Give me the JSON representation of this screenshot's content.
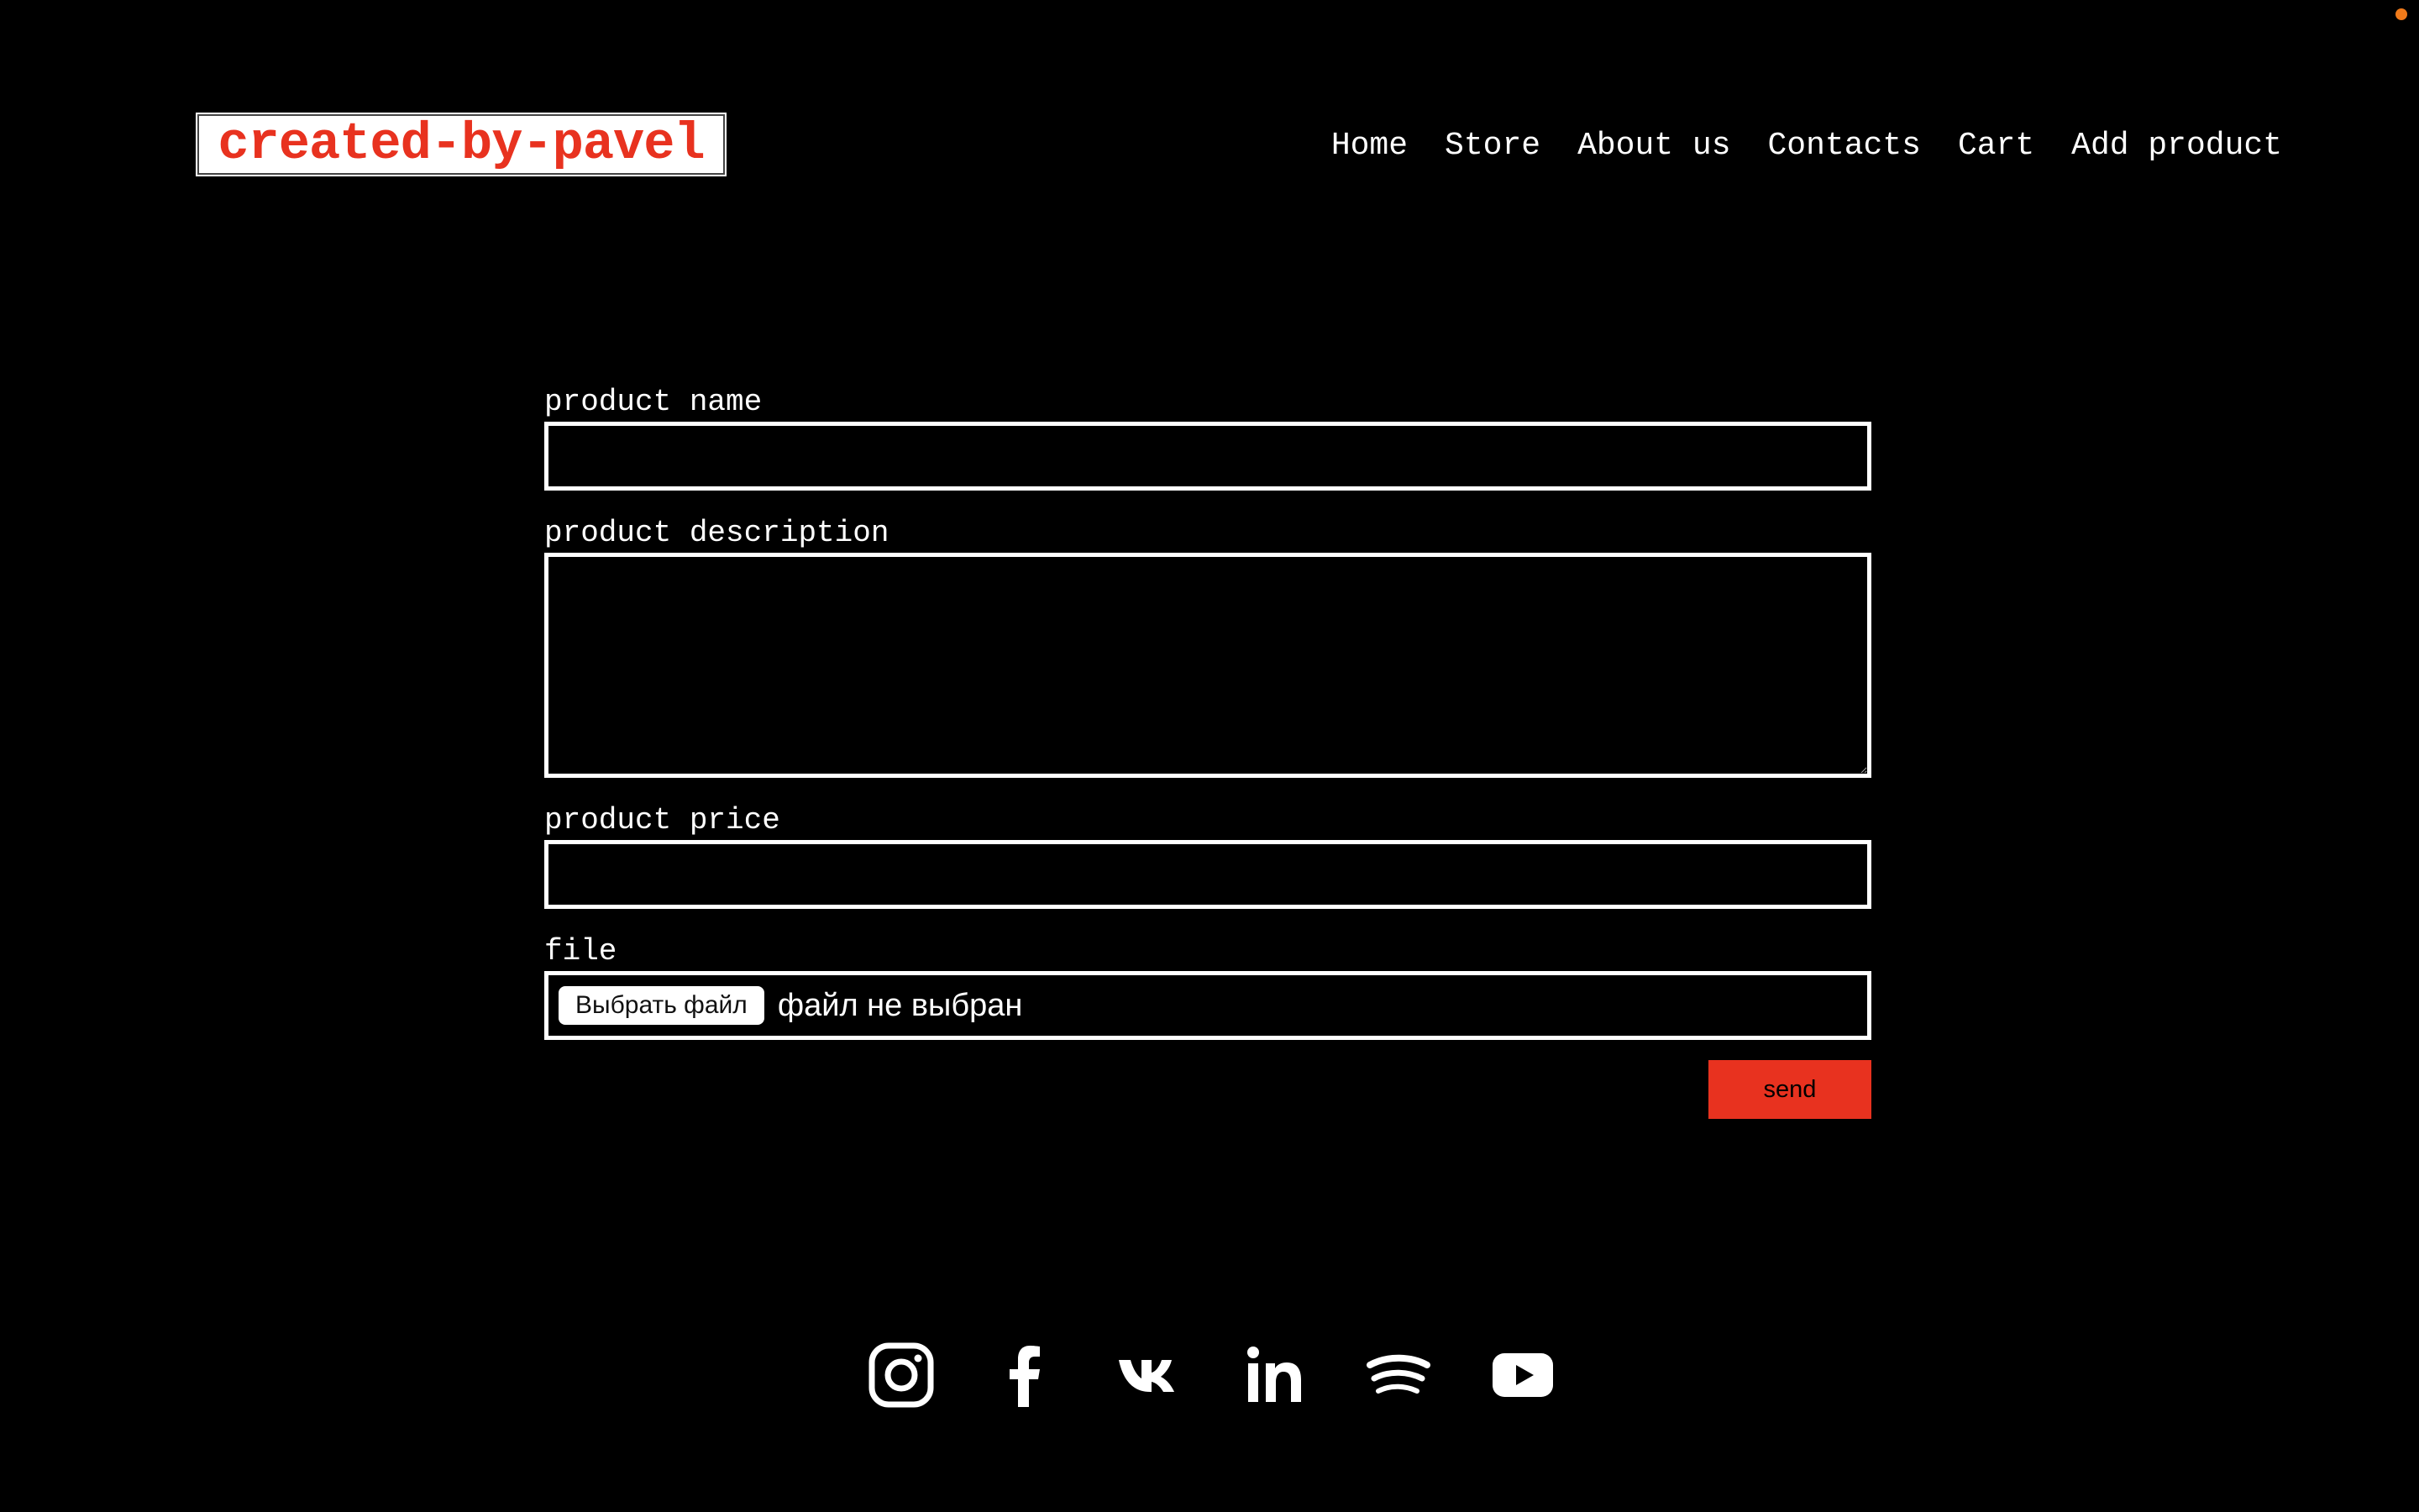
{
  "header": {
    "logo_text": "created-by-pavel",
    "logo_text_color": "#e8321f",
    "nav": [
      {
        "label": "Home"
      },
      {
        "label": "Store"
      },
      {
        "label": "About us"
      },
      {
        "label": "Contacts"
      },
      {
        "label": "Cart"
      },
      {
        "label": "Add product"
      }
    ]
  },
  "form": {
    "name_label": "product name",
    "name_value": "",
    "description_label": "product description",
    "description_value": "",
    "price_label": "product price",
    "price_value": "",
    "file_label": "file",
    "file_button_label": "Выбрать файл",
    "file_status": "файл не выбран",
    "send_label": "send"
  },
  "footer": {
    "socials": [
      {
        "icon": "instagram-icon"
      },
      {
        "icon": "facebook-icon"
      },
      {
        "icon": "vk-icon"
      },
      {
        "icon": "linkedin-icon"
      },
      {
        "icon": "spotify-icon"
      },
      {
        "icon": "youtube-icon"
      }
    ]
  },
  "colors": {
    "background": "#000000",
    "foreground": "#ffffff",
    "accent": "#e8321f",
    "status_dot": "#f07a1a"
  }
}
